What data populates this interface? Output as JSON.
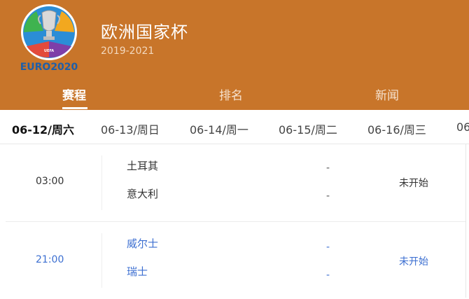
{
  "header": {
    "title": "欧洲国家杯",
    "subtitle": "2019-2021",
    "logo_text": "EURO2020",
    "logo_small": "UEFA",
    "bg_color": "#c8752a"
  },
  "tabs": [
    {
      "label": "赛程",
      "active": true
    },
    {
      "label": "排名",
      "active": false
    },
    {
      "label": "新闻",
      "active": false
    }
  ],
  "dates": [
    {
      "label": "06-12/周六",
      "active": true
    },
    {
      "label": "06-13/周日",
      "active": false
    },
    {
      "label": "06-14/周一",
      "active": false
    },
    {
      "label": "06-15/周二",
      "active": false
    },
    {
      "label": "06-16/周三",
      "active": false
    },
    {
      "label": "06",
      "active": false
    }
  ],
  "matches": [
    {
      "time": "03:00",
      "home": "土耳其",
      "away": "意大利",
      "home_score": "-",
      "away_score": "-",
      "status": "未开始",
      "highlight": false
    },
    {
      "time": "21:00",
      "home": "威尔士",
      "away": "瑞士",
      "home_score": "-",
      "away_score": "-",
      "status": "未开始",
      "highlight": true
    }
  ],
  "colors": {
    "accent_blue": "#3c6fd1",
    "header_orange": "#c8752a"
  }
}
